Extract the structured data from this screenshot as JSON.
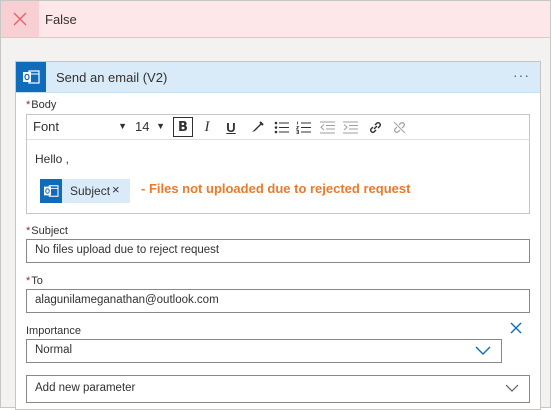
{
  "branch": {
    "title": "False",
    "close_icon": "close-icon"
  },
  "action": {
    "title": "Send an email (V2)",
    "more_label": "···",
    "icon": "outlook-icon"
  },
  "body": {
    "label": "Body",
    "required_mark": "*",
    "toolbar": {
      "font": "Font",
      "size": "14",
      "bold": "B",
      "italic": "I",
      "underline": "U"
    },
    "content": {
      "greeting": "Hello ,",
      "token_label": "Subject",
      "token_remove": "×",
      "message": "- Files not uploaded due to rejected request"
    }
  },
  "subject": {
    "label": "Subject",
    "required_mark": "*",
    "value": "No files upload due to reject request"
  },
  "to": {
    "label": "To",
    "required_mark": "*",
    "value": "alagunilameganathan@outlook.com"
  },
  "importance": {
    "label": "Importance",
    "value": "Normal"
  },
  "add_parameter": {
    "placeholder": "Add new parameter"
  },
  "colors": {
    "branch_bg": "#fde7e9",
    "card_header_bg": "#d9ebf8",
    "outlook_blue": "#0f6cbd",
    "message_orange": "#ea7a2c",
    "required_red": "#a4262c"
  }
}
